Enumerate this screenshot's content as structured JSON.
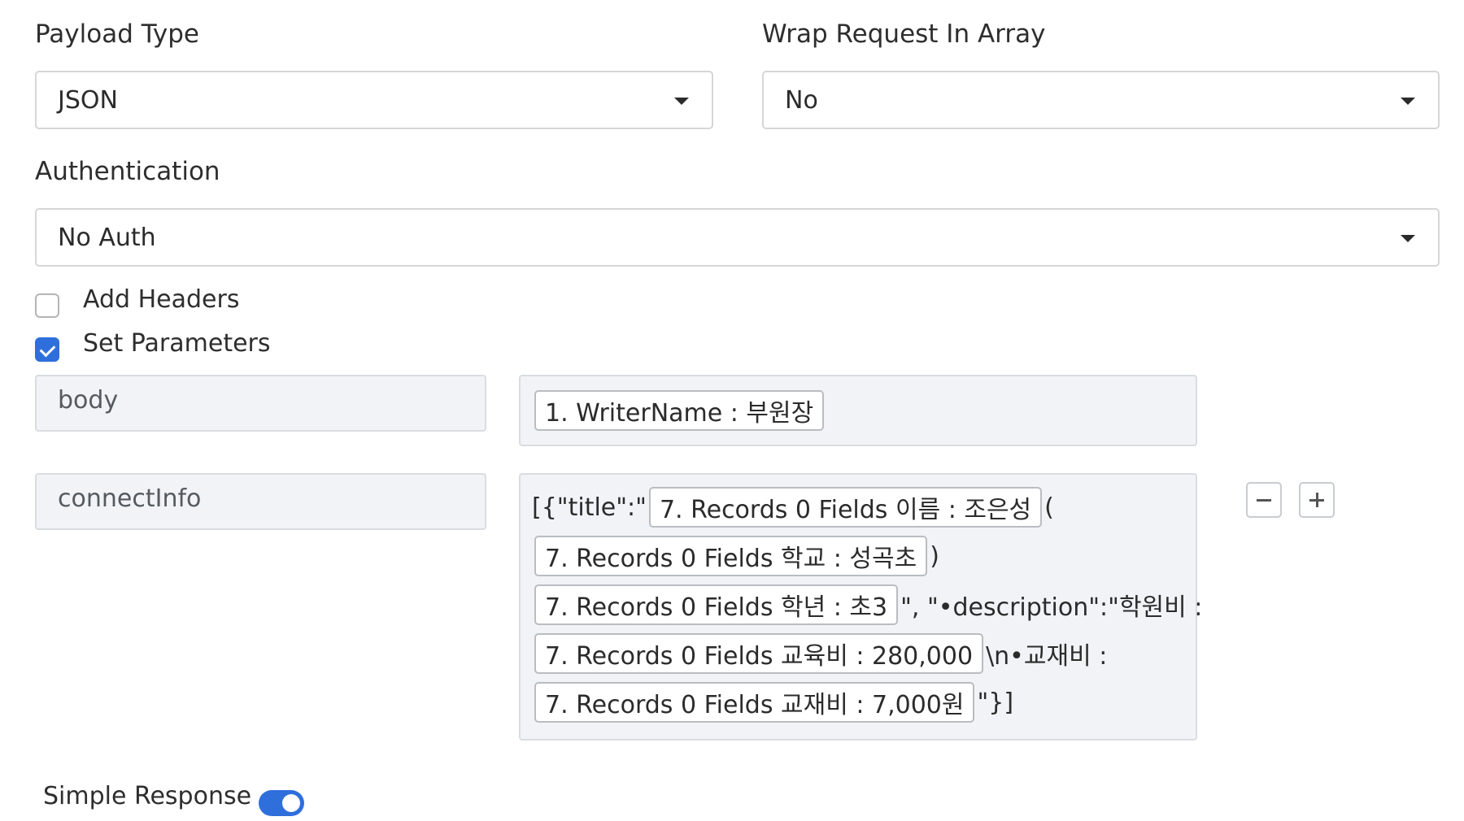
{
  "payload_type": {
    "label": "Payload Type",
    "value": "JSON"
  },
  "wrap_request": {
    "label": "Wrap Request In Array",
    "value": "No"
  },
  "authentication": {
    "label": "Authentication",
    "value": "No Auth"
  },
  "add_headers": {
    "label": "Add Headers",
    "checked": false
  },
  "set_parameters": {
    "label": "Set Parameters",
    "checked": true
  },
  "params": [
    {
      "key": "body",
      "value_chip": "1. WriterName : 부원장"
    },
    {
      "key": "connectInfo",
      "lines": [
        {
          "pre": "[{\"title\":\"",
          "chip": "7. Records 0 Fields 이름 : 조은성",
          "post": "("
        },
        {
          "pre": "",
          "chip": "7. Records 0 Fields 학교 : 성곡초",
          "post": ")"
        },
        {
          "pre": "",
          "chip": "7. Records 0 Fields 학년 : 초3",
          "post": "\", \"•description\":\"학원비 :"
        },
        {
          "pre": "",
          "chip": "7. Records 0 Fields 교육비 : 280,000",
          "post": "\\n•교재비 :"
        },
        {
          "pre": "",
          "chip": "7. Records 0 Fields 교재비 : 7,000원",
          "post": "\"}]"
        }
      ]
    }
  ],
  "simple_response": {
    "label": "Simple Response",
    "enabled": true
  },
  "icons": {
    "remove": "minus-icon",
    "add": "plus-icon",
    "dropdown": "caret-down-icon",
    "check": "check-icon"
  },
  "colors": {
    "accent": "#2f6fdc",
    "field_bg": "#f1f3f6",
    "border": "#d6d6d6"
  }
}
